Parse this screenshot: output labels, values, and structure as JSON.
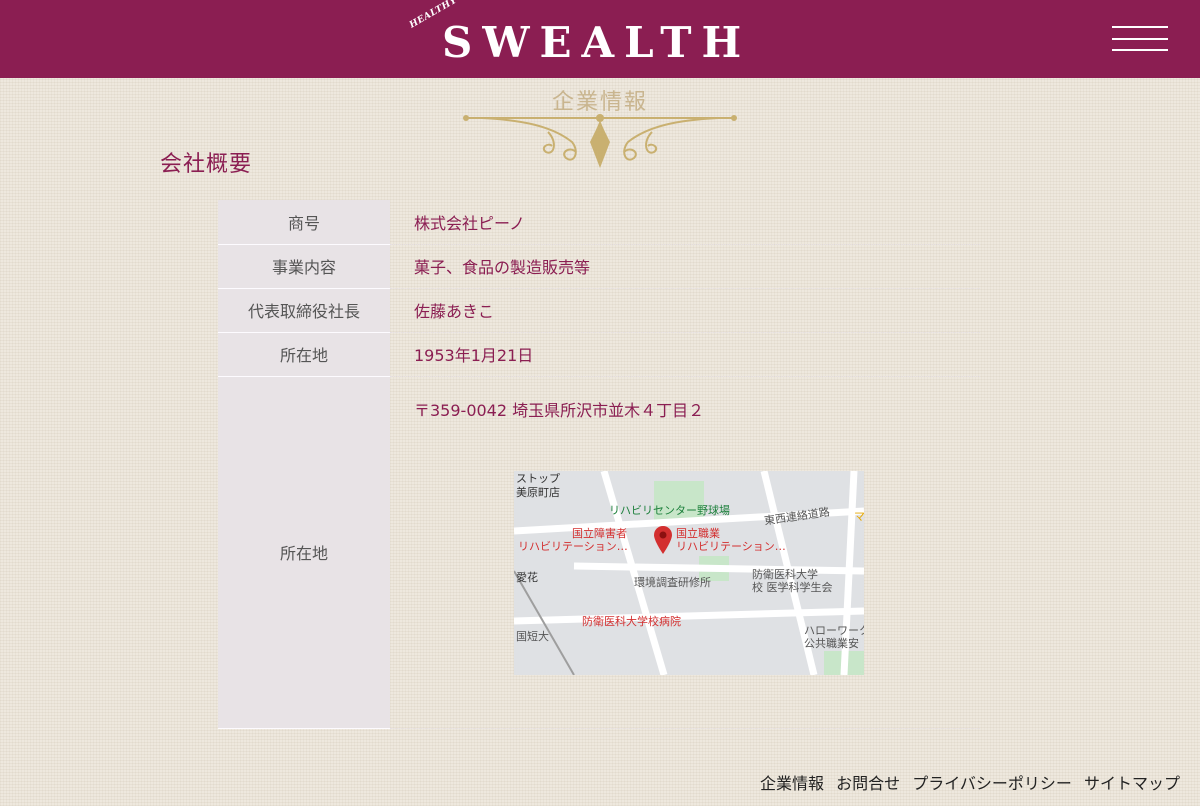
{
  "header": {
    "logo_tagline": "HEALTHY DONUTS",
    "logo_word": "SWEALTH",
    "brand_color": "#8b1e52"
  },
  "section_title": "企業情報",
  "company_heading": "会社概要",
  "rows": [
    {
      "label": "商号",
      "value": "株式会社ピーノ"
    },
    {
      "label": "事業内容",
      "value": "菓子、食品の製造販売等"
    },
    {
      "label": "代表取締役社長",
      "value": "佐藤あきこ"
    },
    {
      "label": "所在地",
      "value": "1953年1月21日"
    },
    {
      "label": "所在地",
      "value": "〒359-0042 埼玉県所沢市並木４丁目２"
    }
  ],
  "map": {
    "labels": {
      "store_1": "ストップ",
      "store_2": "美原町店",
      "baseball": "リハビリセンター野球場",
      "east_road": "東西連絡道路",
      "rehab_left_1": "国立障害者",
      "rehab_left_2": "リハビリテーション…",
      "rehab_right_1": "国立職業",
      "rehab_right_2": "リハビリテーション…",
      "env_lab": "環境調査研修所",
      "medical_1": "防衛医科大学",
      "medical_2": "校 医学科学生会",
      "hospital": "防衛医科大学校病院",
      "junior_college": "国短大",
      "hello_work_1": "ハローワーク",
      "hello_work_2": "公共職業安",
      "hana": "愛花",
      "ma": "マ"
    }
  },
  "footer": {
    "links": [
      "企業情報",
      "お問合せ",
      "プライバシーポリシー",
      "サイトマップ"
    ]
  }
}
